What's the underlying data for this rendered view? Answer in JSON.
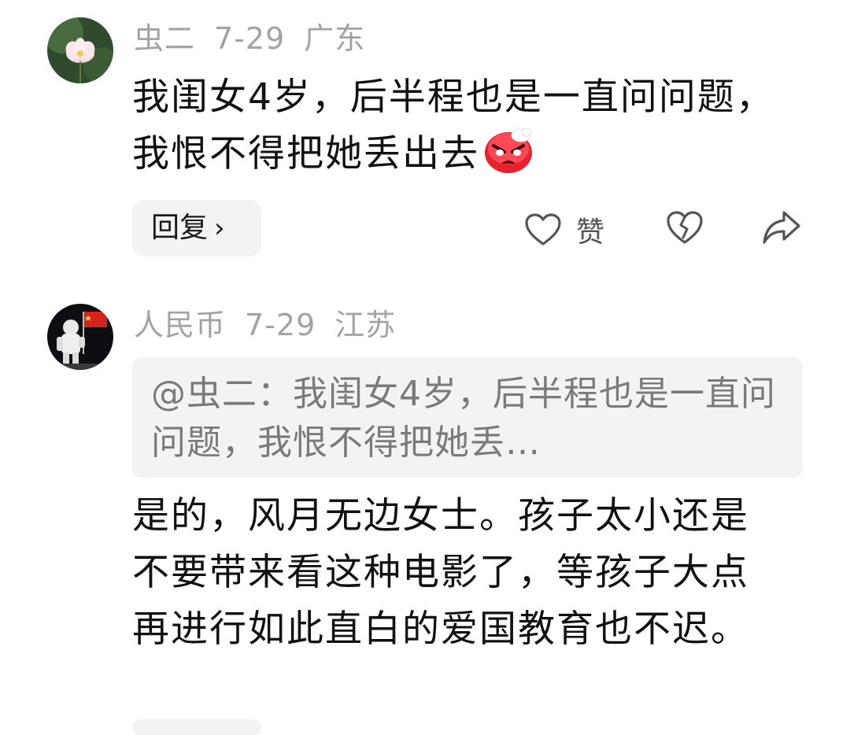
{
  "comments": [
    {
      "author": "虫二",
      "date": "7-29",
      "location": "广东",
      "text": "我闺女4岁，后半程也是一直问问题，我恨不得把她丢出去",
      "emoji": "angry-face-emoji",
      "reply_label": "回复",
      "like_label": "赞"
    },
    {
      "author": "人民币",
      "date": "7-29",
      "location": "江苏",
      "quote": "@虫二：我闺女4岁，后半程也是一直问问题，我恨不得把她丢…",
      "text": "是的，风月无边女士。孩子太小还是不要带来看这种电影了，等孩子大点再进行如此直白的爱国教育也不迟。"
    }
  ],
  "icons": {
    "like": "heart-icon",
    "dislike": "broken-heart-icon",
    "share": "share-arrow-icon",
    "reply_chevron": "chevron-right-icon"
  },
  "colors": {
    "meta_text": "#a3a3a3",
    "button_bg": "#f3f3f3",
    "quote_bg": "#f3f3f4",
    "emoji_red": "#e8212e"
  }
}
